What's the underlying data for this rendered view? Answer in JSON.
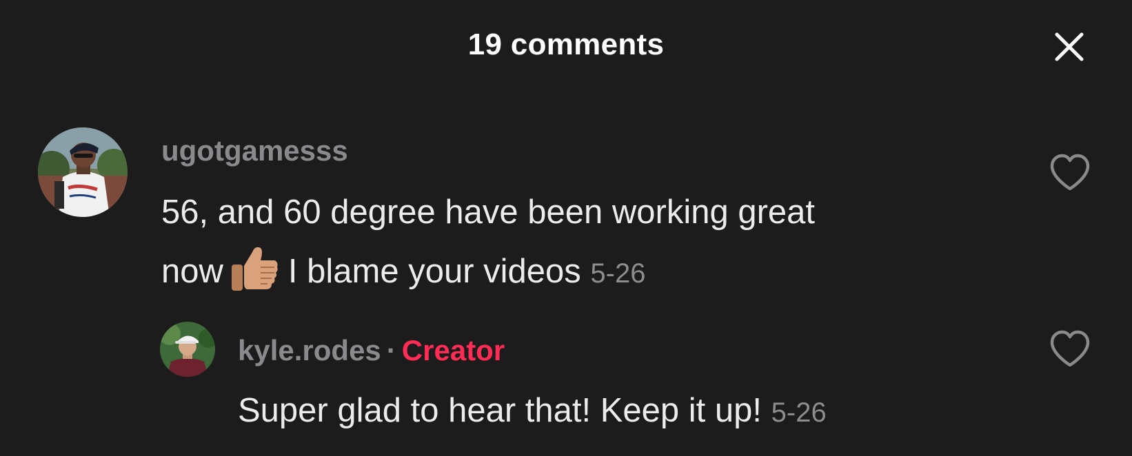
{
  "header": {
    "title": "19 comments"
  },
  "comments": [
    {
      "username": "ugotgamesss",
      "text_line1": "56, and 60 degree have been working great",
      "text_line2_before": "now",
      "emoji": "thumbs-up-medium-skin-tone",
      "text_line2_after": "I blame your videos",
      "timestamp": "5-26",
      "avatar_icon": "user-avatar-baseball-player"
    }
  ],
  "replies": [
    {
      "username": "kyle.rodes",
      "separator": "·",
      "badge": "Creator",
      "text": "Super glad to hear that! Keep it up!",
      "timestamp": "5-26",
      "avatar_icon": "user-avatar-man-white-cap"
    }
  ],
  "colors": {
    "background": "#1c1c1d",
    "primary_text": "#ececec",
    "secondary_text": "#8a8a8d",
    "creator_badge": "#fe2c55"
  }
}
